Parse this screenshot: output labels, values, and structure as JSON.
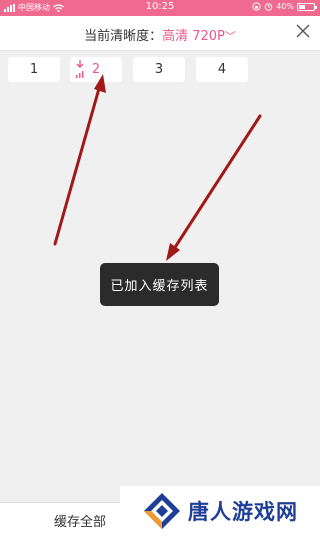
{
  "status_bar": {
    "carrier": "中国移动",
    "time": "10:25",
    "battery": "40%",
    "battery_level": 0.4
  },
  "header": {
    "label": "当前清晰度：",
    "quality": "高清 720P",
    "chevron": "﹀"
  },
  "episodes": [
    {
      "label": "1",
      "state": "normal"
    },
    {
      "label": "2",
      "state": "downloading"
    },
    {
      "label": "3",
      "state": "normal"
    },
    {
      "label": "4",
      "state": "normal"
    }
  ],
  "toast": {
    "text": "已加入缓存列表"
  },
  "bottom": {
    "cache_all": "缓存全部"
  },
  "watermark": {
    "text": "唐人游戏网"
  },
  "colors": {
    "status_bar": "#f06a8f",
    "accent": "#e8588a",
    "arrow": "#a01818",
    "brand_blue": "#1f3e96",
    "brand_orange": "#f29a2e"
  }
}
